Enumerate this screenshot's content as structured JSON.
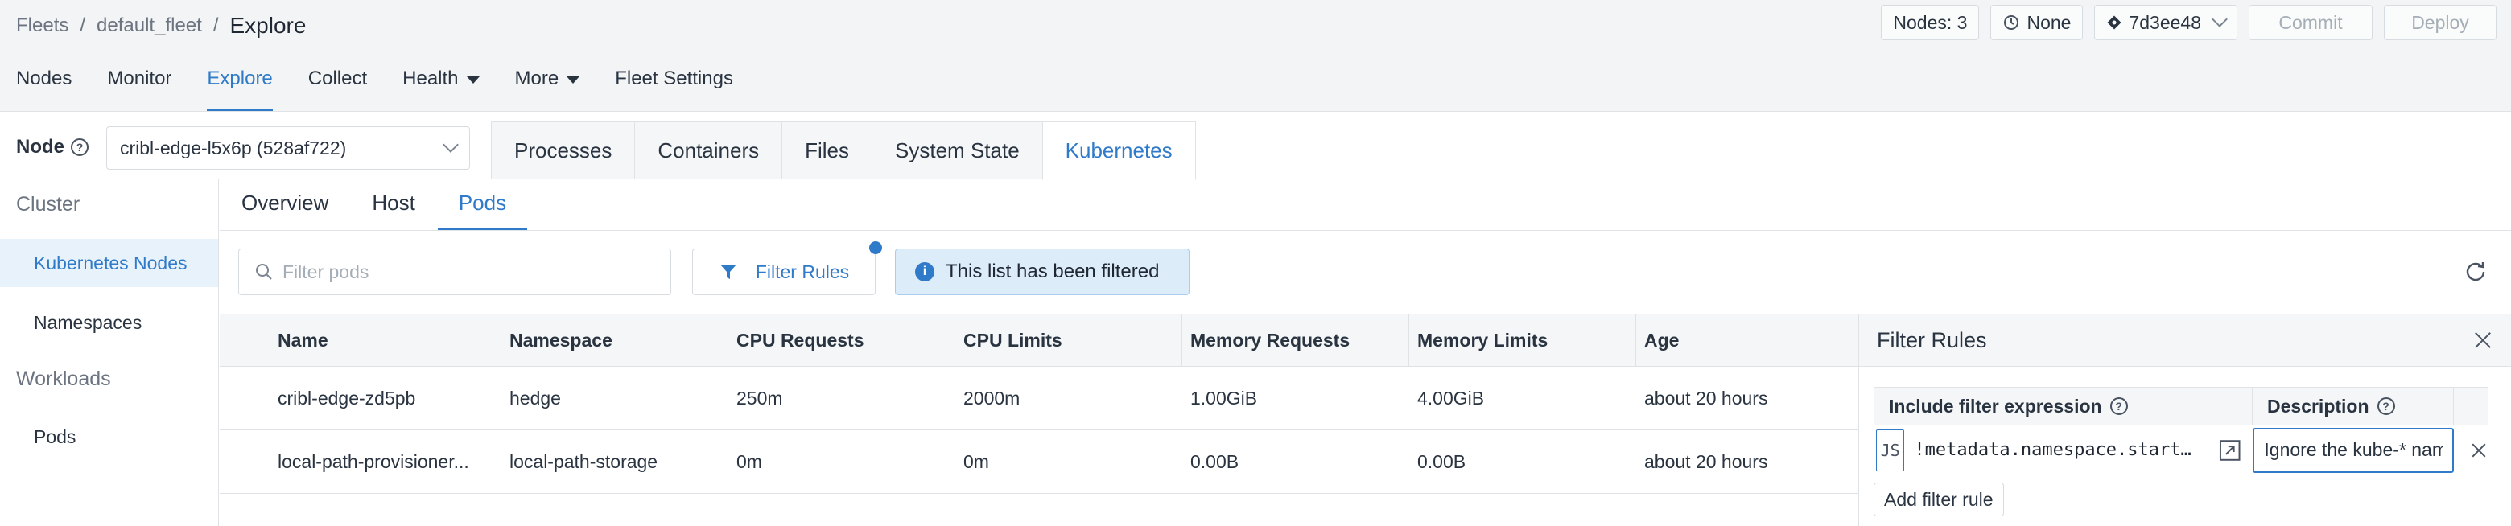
{
  "breadcrumb": {
    "root": "Fleets",
    "fleet": "default_fleet",
    "current": "Explore"
  },
  "header_right": {
    "nodes": "Nodes: 3",
    "none_label": "None",
    "commit_hash": "7d3ee48",
    "commit": "Commit",
    "deploy": "Deploy"
  },
  "nav": {
    "nodes": "Nodes",
    "monitor": "Monitor",
    "explore": "Explore",
    "collect": "Collect",
    "health": "Health",
    "more": "More",
    "fleet_settings": "Fleet Settings"
  },
  "node_bar": {
    "label": "Node",
    "selected": "cribl-edge-l5x6p (528af722)"
  },
  "tabs": {
    "processes": "Processes",
    "containers": "Containers",
    "files": "Files",
    "system_state": "System State",
    "kubernetes": "Kubernetes"
  },
  "sidebar": {
    "cluster": "Cluster",
    "kubernetes_nodes": "Kubernetes Nodes",
    "namespaces": "Namespaces",
    "workloads": "Workloads",
    "pods": "Pods"
  },
  "subtabs": {
    "overview": "Overview",
    "host": "Host",
    "pods": "Pods"
  },
  "toolbar": {
    "filter_placeholder": "Filter pods",
    "filter_rules": "Filter Rules",
    "filtered_note": "This list has been filtered"
  },
  "table": {
    "headers": [
      "Name",
      "Namespace",
      "CPU Requests",
      "CPU Limits",
      "Memory Requests",
      "Memory Limits",
      "Age"
    ],
    "rows": [
      [
        "cribl-edge-zd5pb",
        "hedge",
        "250m",
        "2000m",
        "1.00GiB",
        "4.00GiB",
        "about 20 hours"
      ],
      [
        "local-path-provisioner...",
        "local-path-storage",
        "0m",
        "0m",
        "0.00B",
        "0.00B",
        "about 20 hours"
      ]
    ]
  },
  "panel": {
    "title": "Filter Rules",
    "col_expr": "Include filter expression",
    "col_desc": "Description",
    "rule": {
      "lang": "JS",
      "expression": "!metadata.namespace.startsWith('kube-')",
      "description": "Ignore the kube-* namespaces"
    },
    "add_rule": "Add filter rule"
  },
  "colors": {
    "accent": "#2f7ac9",
    "header_bg": "#f2f4f5",
    "active_bg": "#e8f2fb",
    "note_bg": "#dcecf9"
  }
}
